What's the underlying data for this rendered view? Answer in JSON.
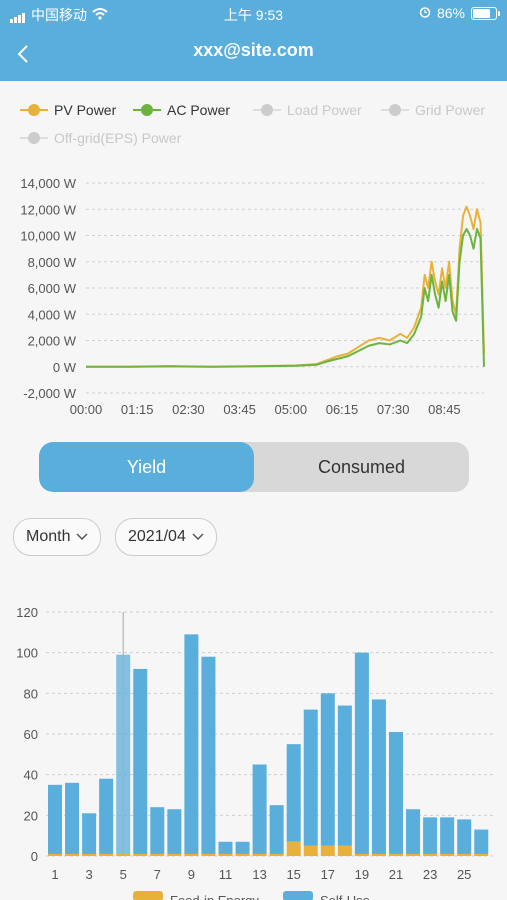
{
  "status": {
    "carrier": "中国移动",
    "time": "上午 9:53",
    "battery": "86%",
    "battery_level": 0.86
  },
  "header": {
    "title": "xxx@site.com",
    "back_icon": "chevron-left-icon"
  },
  "legend": [
    {
      "label": "PV Power",
      "color": "#e8b23a",
      "enabled": true
    },
    {
      "label": "AC Power",
      "color": "#6cb33f",
      "enabled": true
    },
    {
      "label": "Load Power",
      "color": "#c8c8c8",
      "enabled": false
    },
    {
      "label": "Grid Power",
      "color": "#c8c8c8",
      "enabled": false
    },
    {
      "label": "Off-grid(EPS) Power",
      "color": "#c8c8c8",
      "enabled": false
    }
  ],
  "power_chart": {
    "type": "line",
    "ylim": [
      -2000,
      14000
    ],
    "xlim": [
      0,
      570
    ],
    "y_ticks": [
      "-2,000 W",
      "0 W",
      "2,000 W",
      "4,000 W",
      "6,000 W",
      "8,000 W",
      "10,000 W",
      "12,000 W",
      "14,000 W"
    ],
    "x_ticks": [
      "00:00",
      "01:15",
      "02:30",
      "03:45",
      "05:00",
      "06:15",
      "07:30",
      "08:45"
    ],
    "series": [
      {
        "name": "PV Power",
        "color": "#e8b23a",
        "x": [
          0,
          60,
          120,
          180,
          240,
          300,
          330,
          345,
          360,
          375,
          390,
          405,
          420,
          435,
          450,
          460,
          470,
          480,
          485,
          490,
          495,
          500,
          505,
          510,
          515,
          520,
          525,
          530,
          535,
          540,
          545,
          550,
          555,
          560,
          565,
          570
        ],
        "y": [
          0,
          0,
          50,
          0,
          50,
          100,
          200,
          500,
          800,
          1000,
          1500,
          2000,
          2200,
          2000,
          2500,
          2200,
          3000,
          4500,
          7000,
          6000,
          8000,
          6500,
          5500,
          7500,
          6000,
          8000,
          5000,
          4000,
          9000,
          11500,
          12200,
          11500,
          10500,
          12000,
          11000,
          1000
        ]
      },
      {
        "name": "AC Power",
        "color": "#6cb33f",
        "x": [
          0,
          60,
          120,
          180,
          240,
          300,
          330,
          345,
          360,
          375,
          390,
          405,
          420,
          435,
          450,
          460,
          470,
          480,
          485,
          490,
          495,
          500,
          505,
          510,
          515,
          520,
          525,
          530,
          535,
          540,
          545,
          550,
          555,
          560,
          565,
          570
        ],
        "y": [
          0,
          0,
          30,
          0,
          30,
          80,
          150,
          400,
          600,
          800,
          1200,
          1600,
          1800,
          1700,
          2000,
          1800,
          2500,
          3800,
          6000,
          5000,
          7000,
          5500,
          4500,
          6500,
          5000,
          7000,
          4200,
          3500,
          8000,
          10000,
          10500,
          10000,
          9000,
          10500,
          9800,
          0
        ]
      }
    ]
  },
  "segment": {
    "yield": "Yield",
    "consumed": "Consumed"
  },
  "filters": {
    "period": "Month",
    "date": "2021/04"
  },
  "chart_data": {
    "type": "bar",
    "categories": [
      "1",
      "2",
      "3",
      "4",
      "5",
      "6",
      "7",
      "8",
      "9",
      "10",
      "11",
      "12",
      "13",
      "14",
      "15",
      "16",
      "17",
      "18",
      "19",
      "20",
      "21",
      "22",
      "23",
      "24",
      "25",
      "26"
    ],
    "x_tick_labels": [
      "1",
      "3",
      "5",
      "7",
      "9",
      "11",
      "13",
      "15",
      "17",
      "19",
      "21",
      "23",
      "25"
    ],
    "ylim": [
      0,
      120
    ],
    "y_ticks": [
      "0",
      "20",
      "40",
      "60",
      "80",
      "100",
      "120"
    ],
    "selected_index": 4,
    "series": [
      {
        "name": "Feed-in Energy",
        "color": "#e8b23a",
        "values": [
          1,
          1,
          1,
          1,
          1,
          1,
          1,
          1,
          1,
          1,
          1,
          1,
          1,
          1,
          7,
          5,
          5,
          5,
          1,
          1,
          1,
          1,
          1,
          1,
          1,
          1
        ]
      },
      {
        "name": "Self-Use",
        "color": "#5aaedb",
        "values": [
          34,
          35,
          20,
          37,
          98,
          91,
          23,
          22,
          108,
          97,
          6,
          6,
          44,
          24,
          48,
          67,
          75,
          69,
          99,
          76,
          60,
          22,
          18,
          18,
          17,
          12
        ]
      }
    ],
    "legend_labels": [
      "Feed-in Energy",
      "Self-Use"
    ]
  }
}
